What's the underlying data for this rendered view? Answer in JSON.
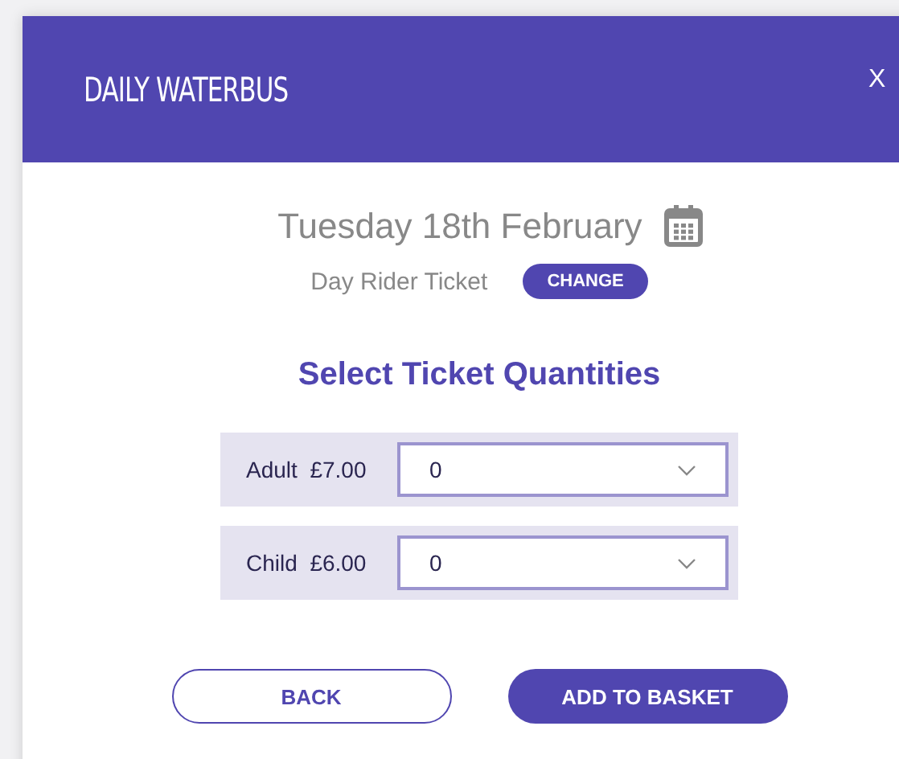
{
  "header": {
    "title": "DAILY WATERBUS",
    "close": "X"
  },
  "date": "Tuesday 18th February",
  "ticket": {
    "name": "Day Rider Ticket",
    "change": "CHANGE"
  },
  "heading": "Select Ticket Quantities",
  "quantities": [
    {
      "label": "Adult",
      "price": "£7.00",
      "value": "0"
    },
    {
      "label": "Child",
      "price": "£6.00",
      "value": "0"
    }
  ],
  "buttons": [
    {
      "label": "BACK",
      "kind": "secondary"
    },
    {
      "label": "ADD TO BASKET",
      "kind": "primary"
    }
  ]
}
